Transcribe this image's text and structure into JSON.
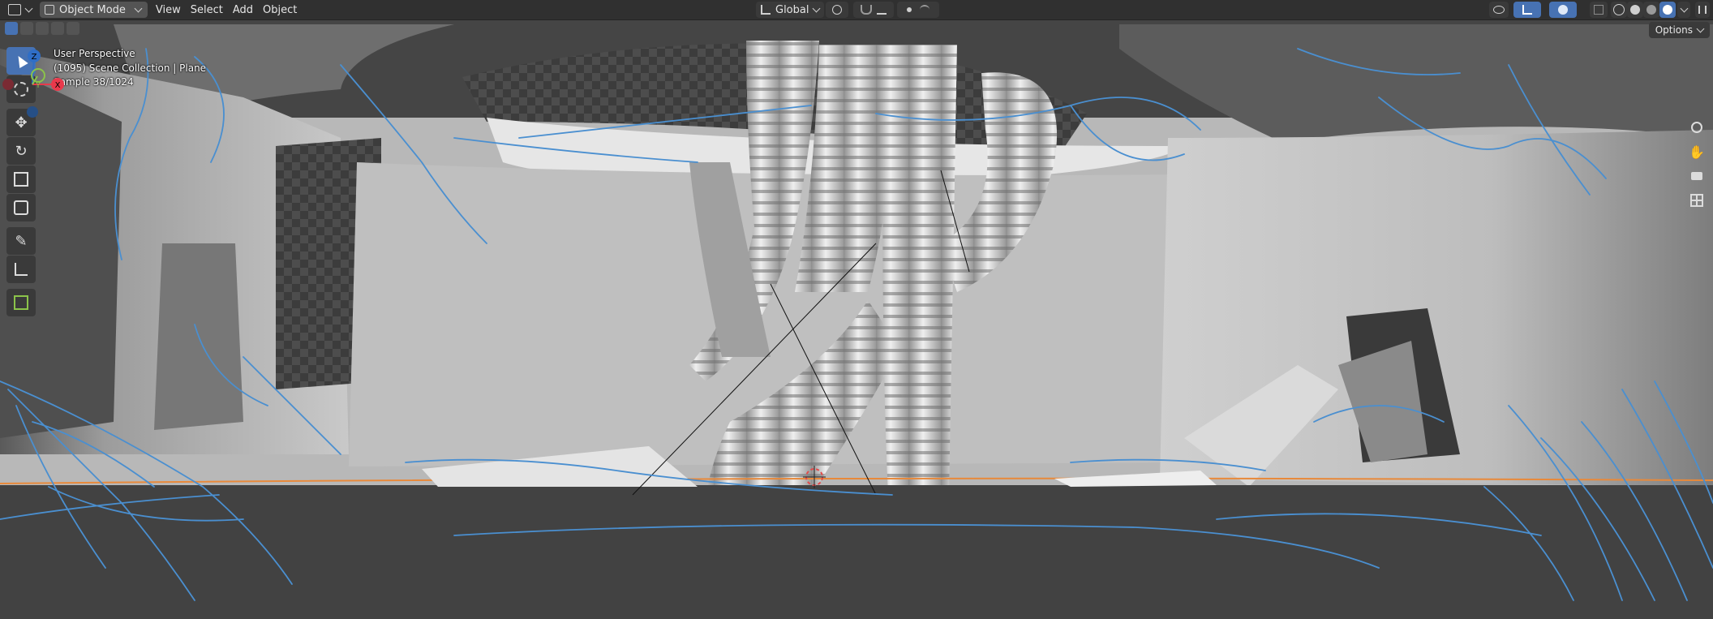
{
  "header": {
    "editor_icon": "viewport-editor-icon",
    "mode_label": "Object Mode",
    "menus": [
      "View",
      "Select",
      "Add",
      "Object"
    ],
    "orientation_label": "Global"
  },
  "options_label": "Options",
  "viewport_info": {
    "perspective": "User Perspective",
    "collection": "(1095) Scene Collection | Plane",
    "sample": "Sample 38/1024"
  },
  "gizmo": {
    "z": "Z",
    "y": "Y",
    "x": "X"
  },
  "colors": {
    "accent": "#4772b3",
    "header_bg": "#303030",
    "annotation_stroke": "#4a8fd0",
    "x_axis": "#e8394b",
    "y_axis": "#8bc34a",
    "z_axis": "#2f6ec7",
    "ground_line": "#e8893a"
  },
  "icons": {
    "tools": [
      "select-box-icon",
      "cursor-icon",
      "move-icon",
      "rotate-icon",
      "scale-icon",
      "transform-icon",
      "annotate-icon",
      "measure-icon",
      "add-cube-icon"
    ],
    "nav": [
      "zoom-icon",
      "hand-pan-icon",
      "camera-icon",
      "grid-toggle-icon"
    ]
  }
}
